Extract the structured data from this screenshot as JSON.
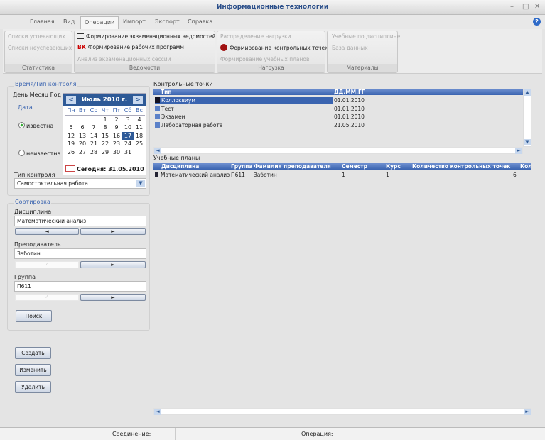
{
  "window": {
    "title": "Информационные технологии",
    "min": "–",
    "max": "□",
    "close": "✕"
  },
  "tabs": [
    "Главная",
    "Вид",
    "Операции",
    "Импорт",
    "Экспорт",
    "Справка"
  ],
  "ribbon": {
    "groups": [
      {
        "label": "Статистика",
        "items": [
          "Списки успевающих",
          "Списки неуспевающих"
        ]
      },
      {
        "label": "Ведомости",
        "items": [
          "Формирование экзаменационных ведомостей",
          "Формирование рабочих программ",
          "Анализ экзаменационных сессий"
        ]
      },
      {
        "label": "Нагрузка",
        "items": [
          "Распределение нагрузки",
          "Формирование контрольных точек",
          "Формирование учебных планов"
        ]
      },
      {
        "label": "Материалы",
        "items": [
          "Учебные по дисциплине",
          "База данных"
        ]
      }
    ]
  },
  "left": {
    "time_group": "Время/Тип контроля",
    "format": "День Месяц Год",
    "date_label": "Дата",
    "radio_known": "известна",
    "radio_unknown": "неизвестна",
    "calendar": {
      "month": "Июль 2010 г.",
      "weekdays": [
        "Пн",
        "Вт",
        "Ср",
        "Чт",
        "Пт",
        "Сб",
        "Вс"
      ],
      "selected": "17",
      "today": "Сегодня: 31.05.2010",
      "days": [
        "",
        "",
        "",
        "1",
        "2",
        "3",
        "4",
        "5",
        "6",
        "7",
        "8",
        "9",
        "10",
        "11",
        "12",
        "13",
        "14",
        "15",
        "16",
        "17",
        "18",
        "19",
        "20",
        "21",
        "22",
        "23",
        "24",
        "25",
        "26",
        "27",
        "28",
        "29",
        "30",
        "31",
        ""
      ]
    },
    "control_type_label": "Тип контроля",
    "control_type_value": "Самостоятельная работа",
    "sort_group": "Сортировка",
    "discipline_label": "Дисциплина",
    "discipline_value": "Математический анализ",
    "teacher_label": "Преподаватель",
    "teacher_value": "Заботин",
    "group_label": "Группа",
    "group_value": "П611",
    "prev": "◄",
    "next": "►",
    "search": "Поиск",
    "create": "Создать",
    "edit": "Изменить",
    "delete": "Удалить"
  },
  "checkpoints": {
    "title": "Контрольные точки",
    "columns": [
      "Тип",
      "ДД.ММ.ГГ"
    ],
    "rows": [
      [
        "Коллоквиум",
        "01.01.2010"
      ],
      [
        "Тест",
        "01.01.2010"
      ],
      [
        "Экзамен",
        "01.01.2010"
      ],
      [
        "Лабораторная работа",
        "21.05.2010"
      ]
    ]
  },
  "plans": {
    "title": "Учебные планы",
    "columns": [
      "Дисциплина",
      "Группа",
      "Фамилия преподавателя",
      "Семестр",
      "Курс",
      "Количество контрольных точек",
      "Кол"
    ],
    "rows": [
      [
        "Математический анализ",
        "П611",
        "Заботин",
        "1",
        "1",
        "",
        "6"
      ]
    ]
  },
  "status": {
    "connection": "Соединение:",
    "operation": "Операция:"
  }
}
